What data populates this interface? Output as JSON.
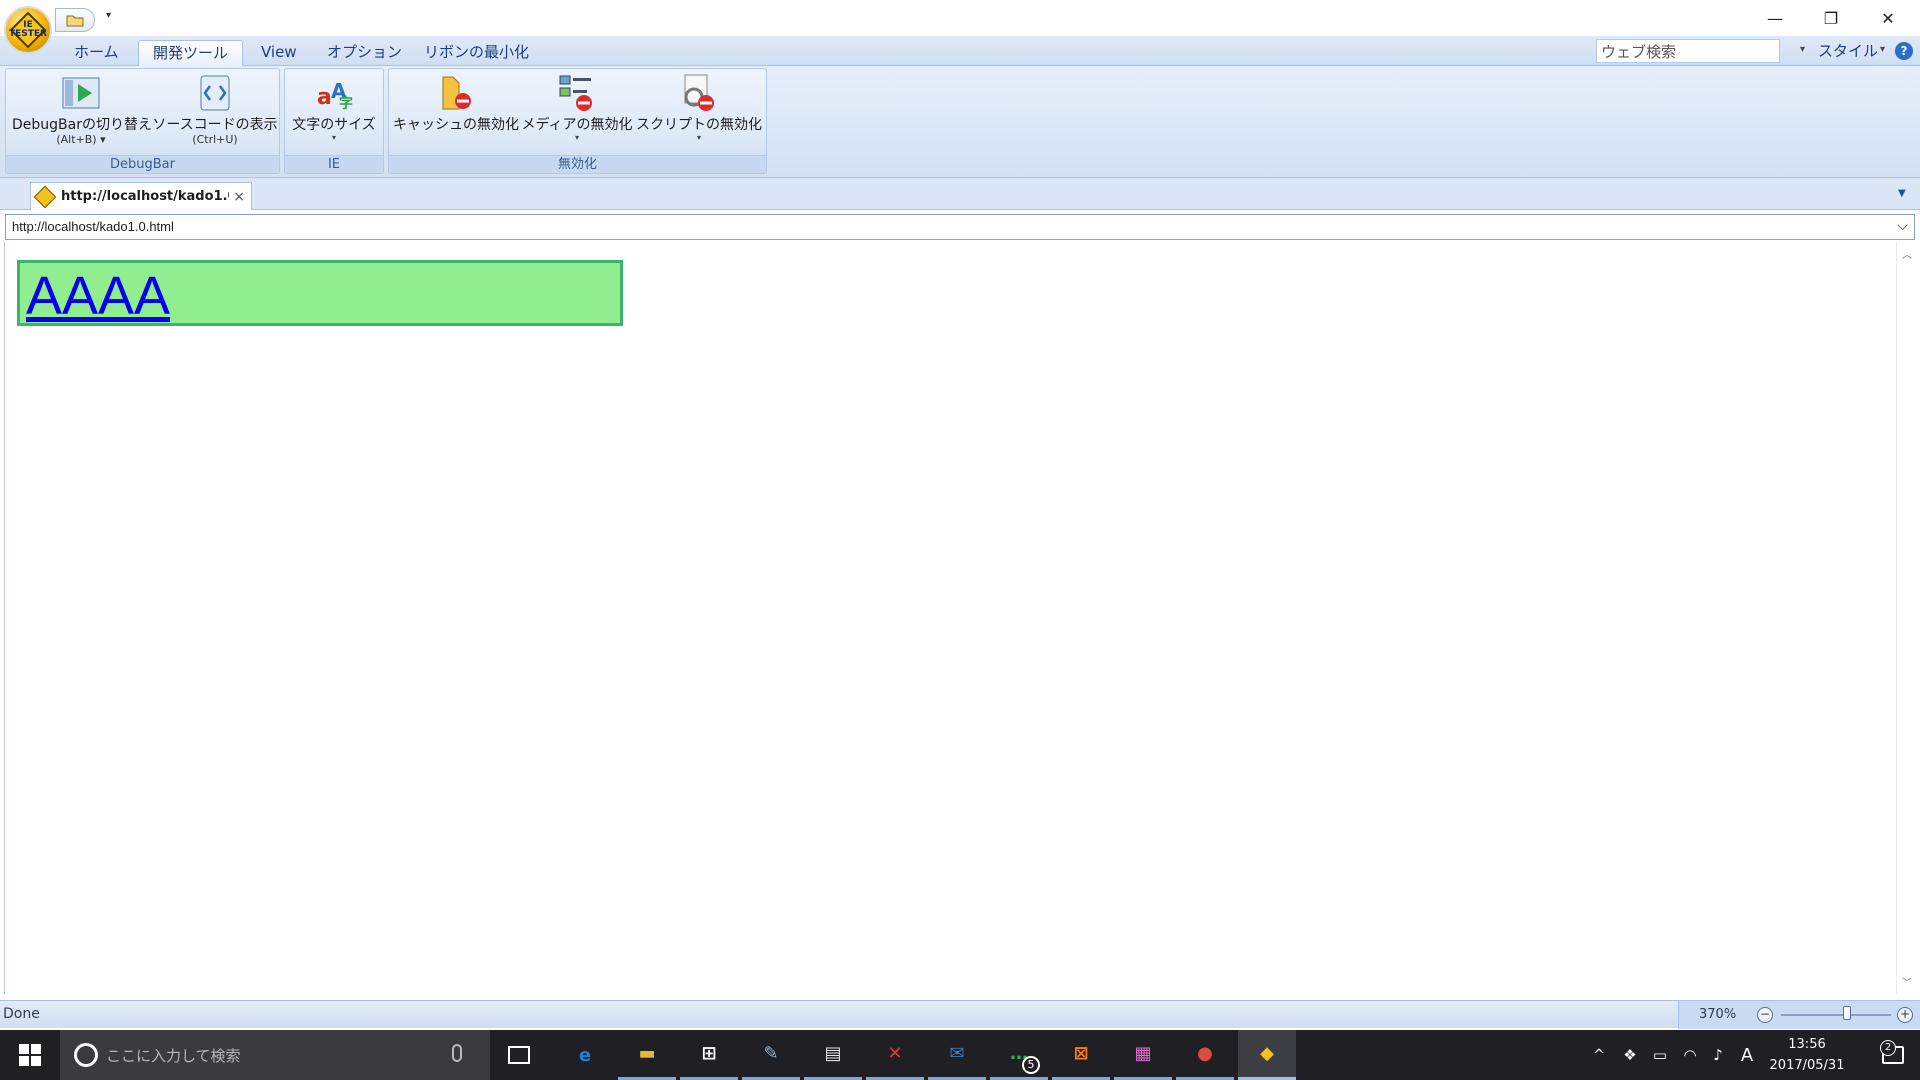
{
  "window": {
    "minimize": "—",
    "restore": "❐",
    "close": "✕",
    "orb_text": "IE\nTESTER"
  },
  "ribbon_tabs": [
    "ホーム",
    "開発ツール",
    "View",
    "オプション",
    "リボンの最小化"
  ],
  "active_tab": "開発ツール",
  "search": {
    "value": "ウェブ検索"
  },
  "style_menu": "スタイル",
  "help": "?",
  "groups": {
    "debugbar": {
      "label": "DebugBar",
      "toggle": {
        "label": "DebugBarの切り替え",
        "shortcut": "(Alt+B)"
      },
      "source": {
        "label": "ソースコードの表示",
        "shortcut": "(Ctrl+U)"
      }
    },
    "ie": {
      "label": "IE",
      "font_size": {
        "label": "文字のサイズ"
      }
    },
    "disable": {
      "label": "無効化",
      "cache": {
        "label": "キャッシュの無効化"
      },
      "media": {
        "label": "メディアの無効化"
      },
      "script": {
        "label": "スクリプトの無効化"
      }
    }
  },
  "doc_tab": {
    "title": "http://localhost/kado1.0...",
    "close": "×"
  },
  "address": "http://localhost/kado1.0.html",
  "page": {
    "link_text": "AAAA"
  },
  "status": {
    "text": "Done",
    "zoom": "370%",
    "zoom_level_fraction": 0.6
  },
  "taskbar": {
    "search_placeholder": "ここに入力して検索",
    "apps": [
      {
        "name": "edge",
        "glyph": "e",
        "color": "#1e7fd8"
      },
      {
        "name": "file-explorer",
        "glyph": "▬",
        "color": "#e8b73a"
      },
      {
        "name": "store",
        "glyph": "⊞",
        "color": "#ffffff"
      },
      {
        "name": "paint",
        "glyph": "✎",
        "color": "#8fb4d9"
      },
      {
        "name": "video-editor",
        "glyph": "▤",
        "color": "#e8e8e8"
      },
      {
        "name": "xmind",
        "glyph": "✕",
        "color": "#e0393e"
      },
      {
        "name": "thunderbird",
        "glyph": "✉",
        "color": "#3a7ec4"
      },
      {
        "name": "line",
        "glyph": "…",
        "color": "#2bb24c",
        "badge": "5"
      },
      {
        "name": "xampp",
        "glyph": "⊠",
        "color": "#f27b21"
      },
      {
        "name": "notes",
        "glyph": "▦",
        "color": "#e46ad0"
      },
      {
        "name": "chrome",
        "glyph": "●",
        "color": "#dd4b39"
      },
      {
        "name": "ie-tester",
        "glyph": "◆",
        "color": "#f3c11d"
      }
    ],
    "tray": {
      "chevron": "^",
      "ime": "A"
    },
    "time": "13:56",
    "date": "2017/05/31",
    "notifications": "2"
  }
}
